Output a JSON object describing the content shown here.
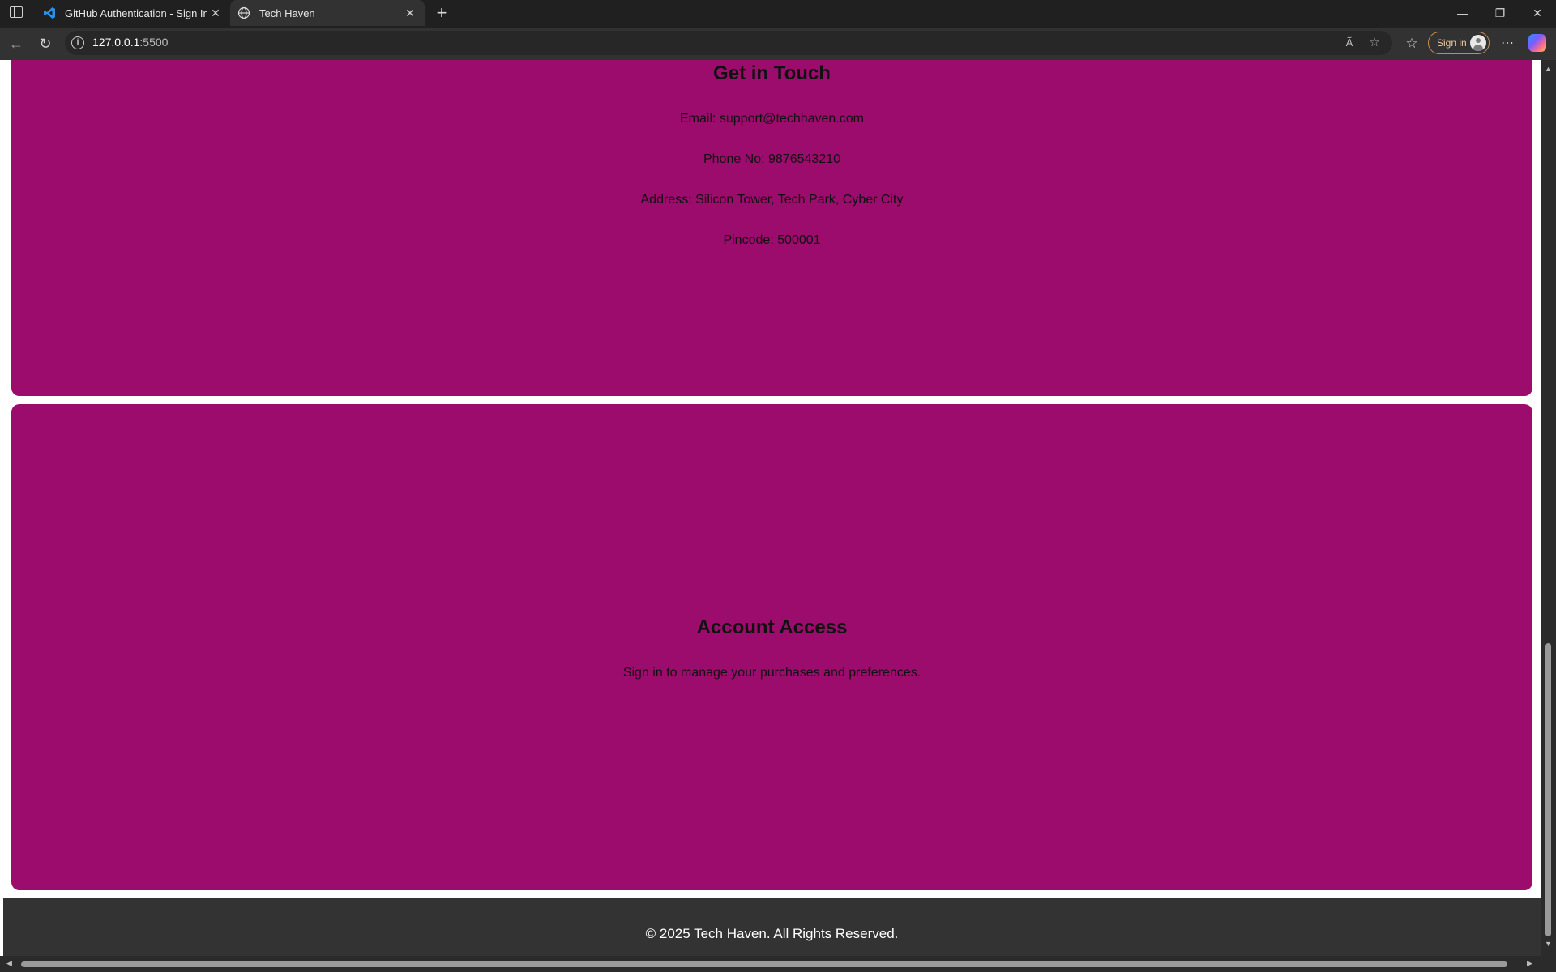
{
  "browser": {
    "tabs": [
      {
        "title": "GitHub Authentication - Sign In",
        "icon": "vscode-icon",
        "active": false
      },
      {
        "title": "Tech Haven",
        "icon": "globe-icon",
        "active": true
      }
    ],
    "address": {
      "host": "127.0.0.1",
      "port": ":5500"
    },
    "signin_label": "Sign in",
    "accent": "#c98a4a"
  },
  "contact": {
    "heading": "Get in Touch",
    "email": "Email: support@techhaven.com",
    "phone": "Phone No: 9876543210",
    "address": "Address: Silicon Tower, Tech Park, Cyber City",
    "pincode": "Pincode: 500001"
  },
  "account": {
    "heading": "Account Access",
    "text": "Sign in to manage your purchases and preferences."
  },
  "footer": {
    "text": "© 2025 Tech Haven. All Rights Reserved."
  },
  "colors": {
    "card_bg": "#9c0c6c",
    "footer_bg": "#333333"
  }
}
